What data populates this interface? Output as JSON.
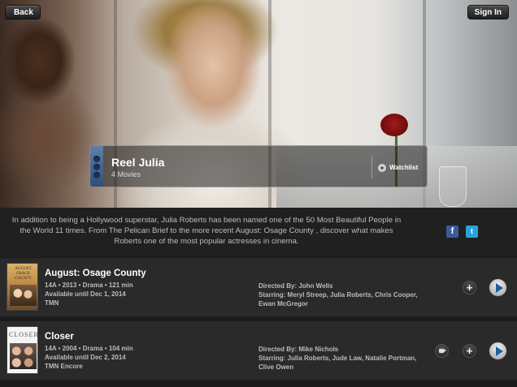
{
  "header": {
    "back_label": "Back",
    "signin_label": "Sign In"
  },
  "collection": {
    "title": "Reel Julia",
    "count": "4 Movies",
    "watchlist_label": "Watchlist",
    "accent_color": "#3c5f8e"
  },
  "description": "In addition to being a Hollywood superstar, Julia Roberts has been named one of the 50 Most Beautiful People in the World 11 times. From The Pelican Brief to the more recent August: Osage County , discover what makes Roberts one of the most popular actresses in cinema.",
  "social": {
    "facebook_glyph": "f",
    "twitter_glyph": "t"
  },
  "movies": [
    {
      "title": "August: Osage County",
      "poster_text": "AUGUST OSAGE COUNTY",
      "meta": "14A • 2013 • Drama • 121 min",
      "availability": "Available until Dec 1, 2014",
      "channel": "TMN",
      "director": "Directed By: John Wells",
      "starring": "Starring: Meryl Streep, Julia Roberts, Chris Cooper, Ewan McGregor"
    },
    {
      "title": "Closer",
      "poster_text": "CLOSER",
      "meta": "14A • 2004 • Drama • 104 min",
      "availability": "Available until Dec 2, 2014",
      "channel": "TMN Encore",
      "director": "Directed By: Mike Nichols",
      "starring": "Starring: Julia Roberts, Jude Law, Natalie Portman, Clive Owen"
    }
  ],
  "icons": {
    "add": "+",
    "play": "play-icon",
    "trailer": "camera-icon"
  }
}
